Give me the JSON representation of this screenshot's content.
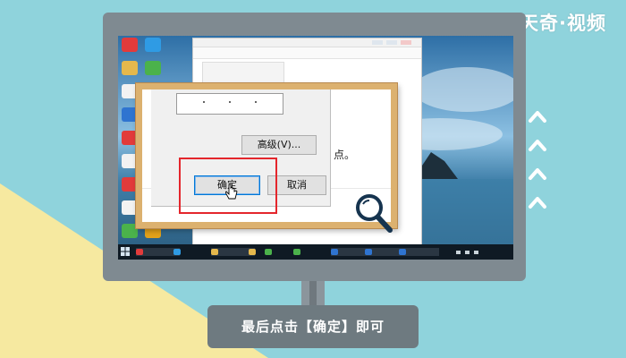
{
  "watermark": "天奇·视频",
  "caption": "最后点击【确定】即可",
  "dialog": {
    "advanced_button": "高级(V)...",
    "ok_button": "确定",
    "cancel_button": "取消"
  },
  "background_text": "点。",
  "colors": {
    "background_cyan": "#8fd3dc",
    "background_yellow": "#f6e9a0",
    "monitor_bezel": "#7f8a91",
    "frame_wood": "#dcb16f",
    "highlight_red": "#e4262c",
    "ok_button_border": "#0078d7"
  },
  "icons": [
    "chevron-up-icon",
    "magnifier-icon",
    "cursor-icon",
    "windows-start-icon"
  ]
}
